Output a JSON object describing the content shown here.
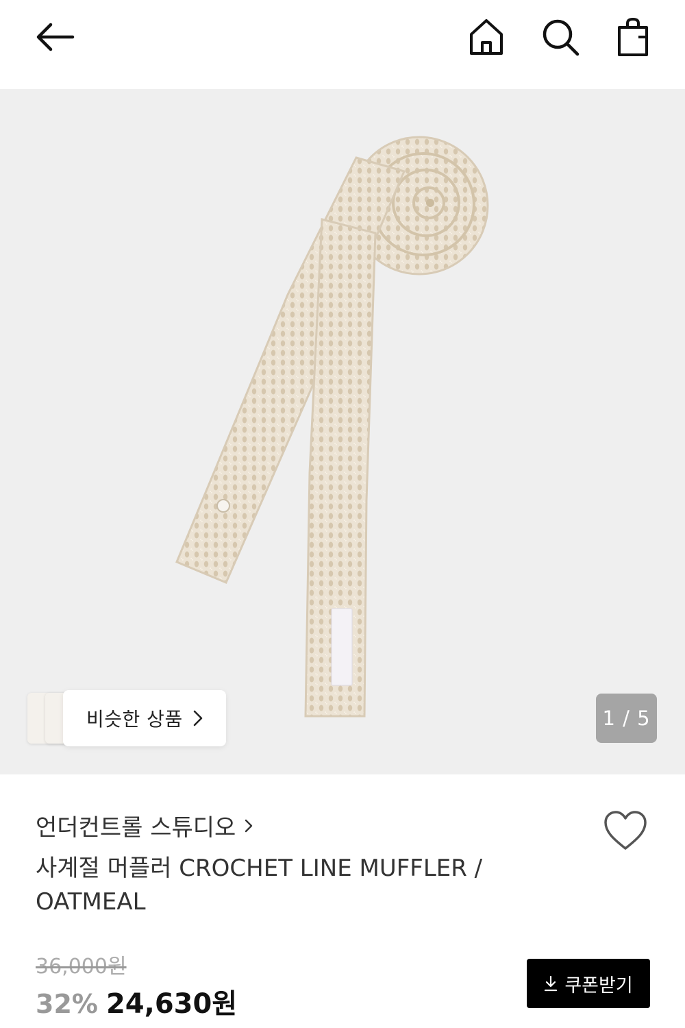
{
  "header": {
    "back_icon": "arrow-left-icon",
    "home_icon": "home-icon",
    "search_icon": "search-icon",
    "bag_icon": "shopping-bag-icon"
  },
  "gallery": {
    "similar_label": "비슷한 상품",
    "counter": "1 / 5",
    "current_image": 1,
    "total_images": 5
  },
  "product": {
    "brand": "언더컨트롤 스튜디오",
    "title": "사계절 머플러 CROCHET LINE MUFFLER / OATMEAL",
    "original_price": "36,000원",
    "discount": "32%",
    "price": "24,630원",
    "coupon_label": "쿠폰받기",
    "wish_icon": "heart-outline-icon"
  },
  "colors": {
    "gallery_bg": "#efefef",
    "scarf": "#e9dfcf",
    "coupon_bg": "#000000",
    "counter_bg": "#8c8c8c"
  }
}
